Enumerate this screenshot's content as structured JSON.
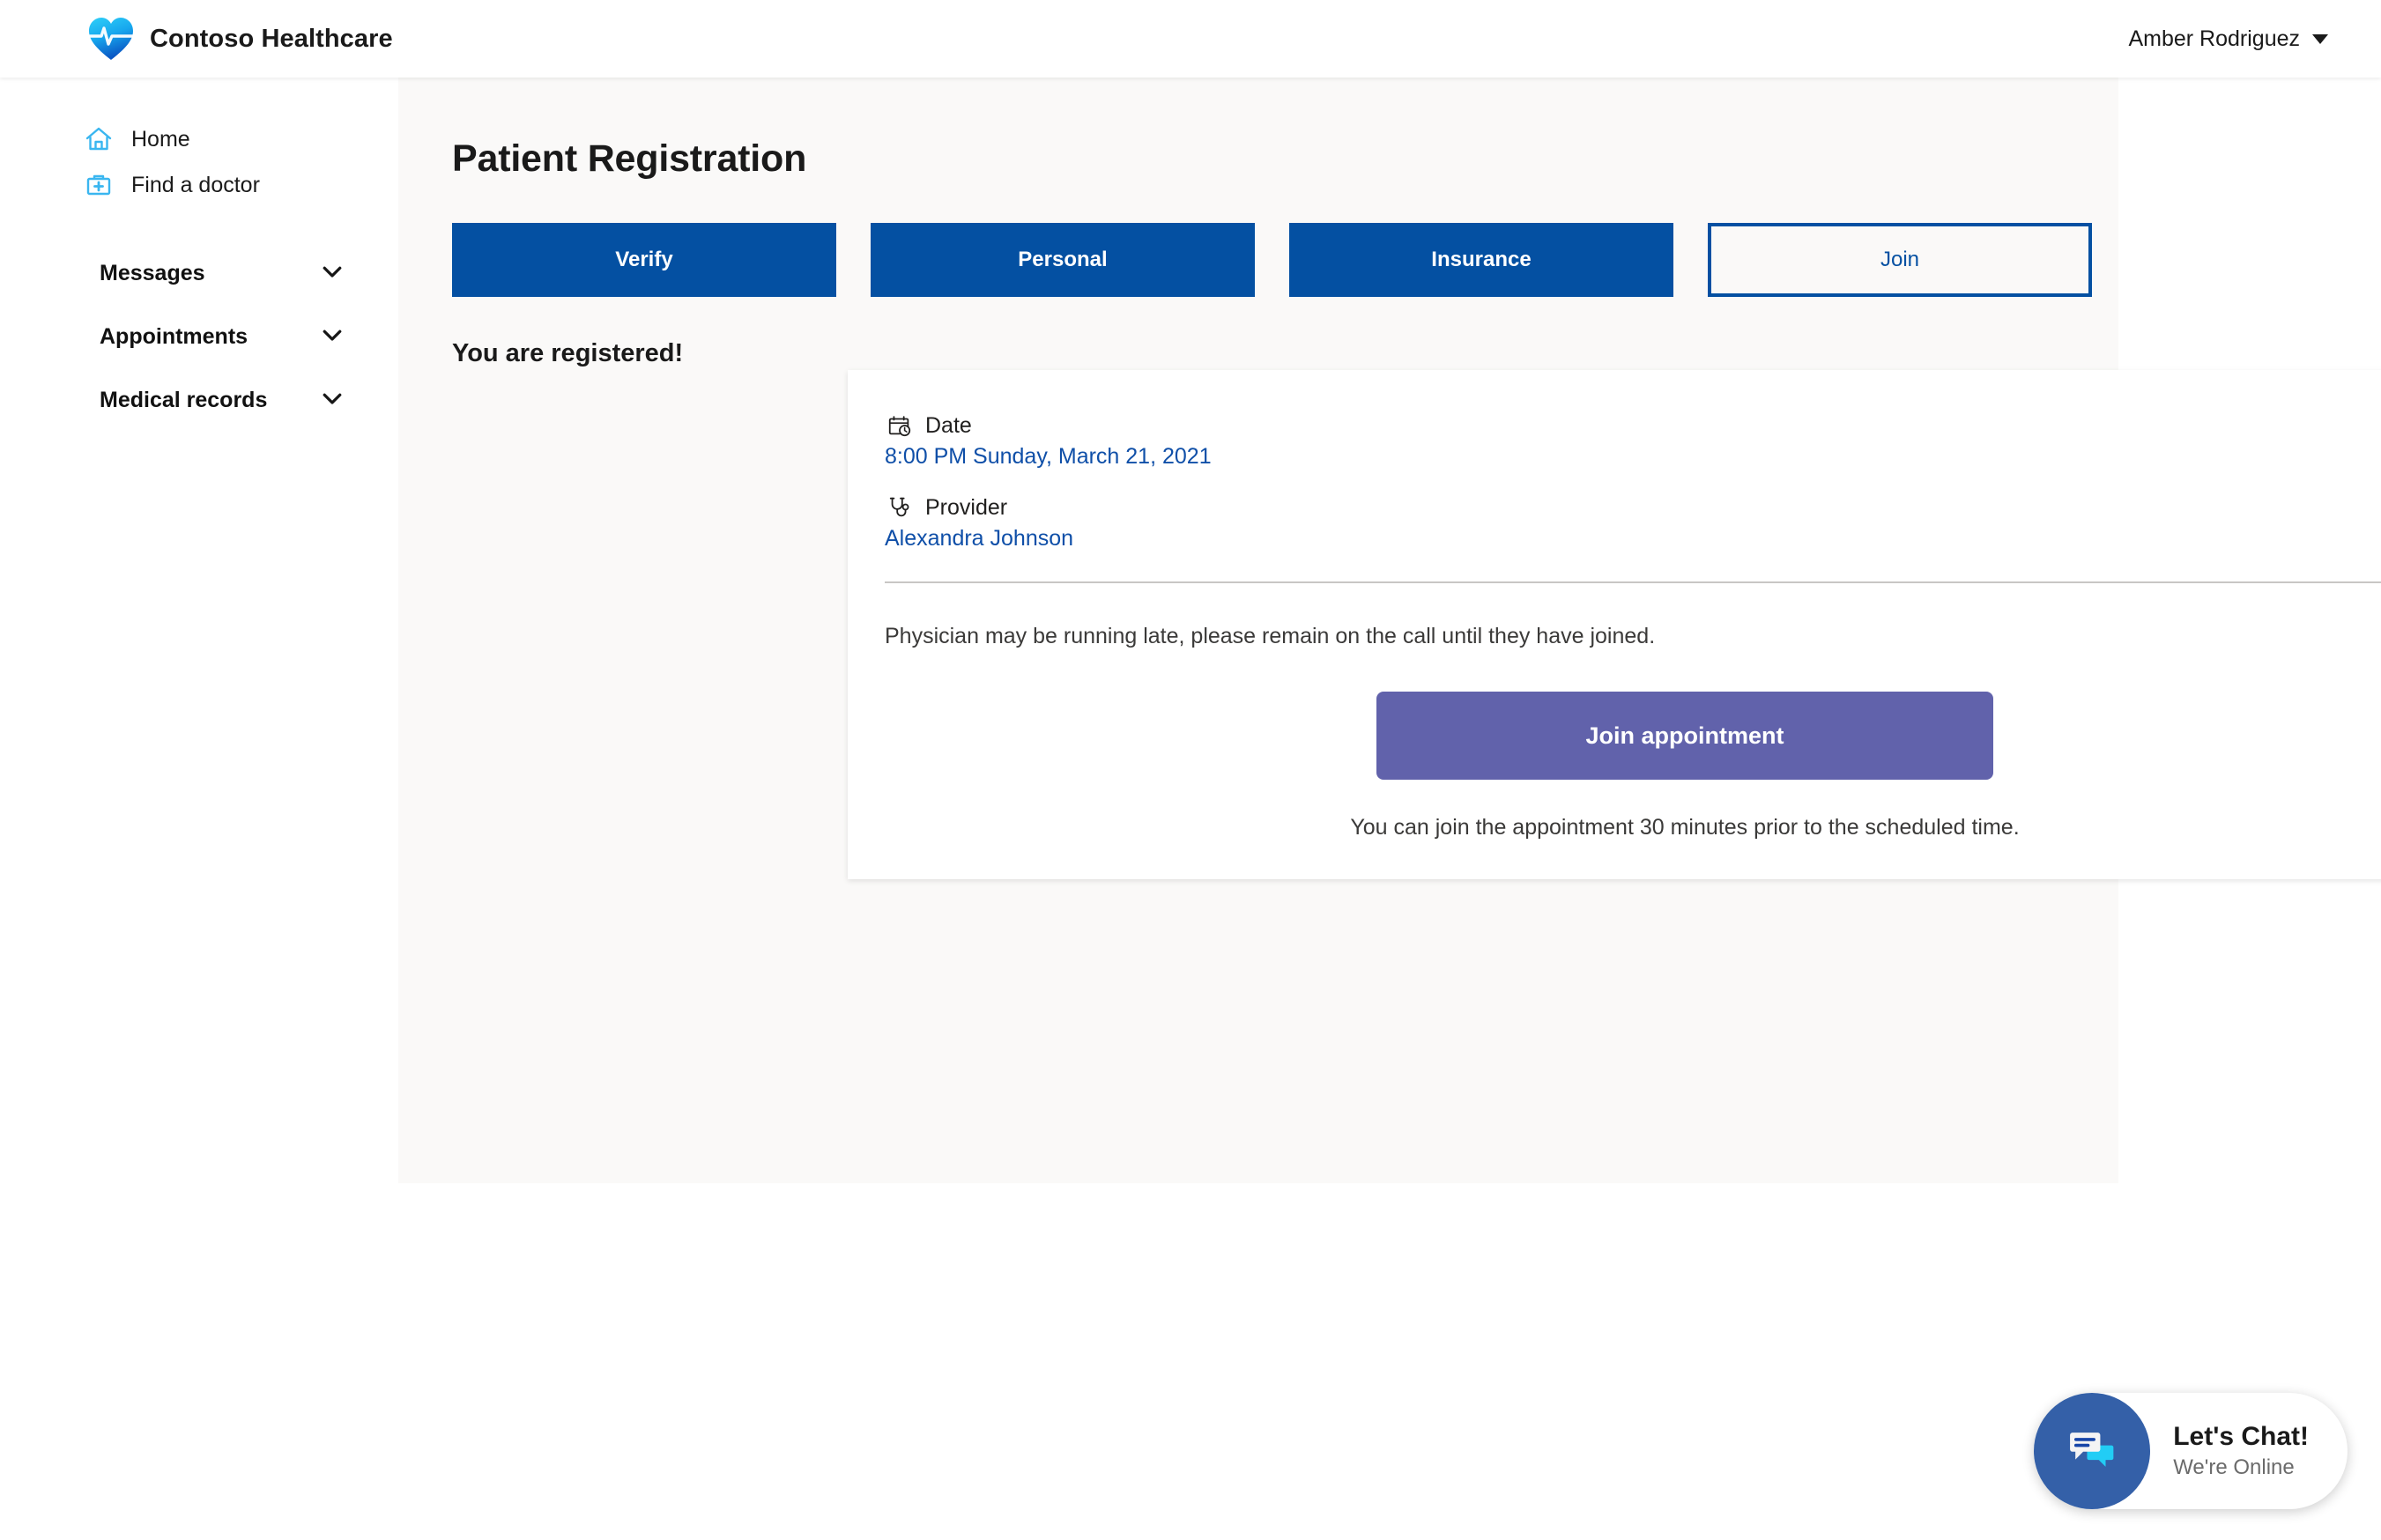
{
  "header": {
    "brand_name": "Contoso Healthcare",
    "logo_icon": "heart-pulse-icon",
    "user_name": "Amber Rodriguez",
    "caret_icon": "caret-down-icon",
    "accent_blue": "#0450a2",
    "logo_cyan": "#2cc4f5"
  },
  "sidebar": {
    "links": [
      {
        "label": "Home",
        "icon": "home-icon"
      },
      {
        "label": "Find a doctor",
        "icon": "medical-bag-icon"
      }
    ],
    "groups": [
      {
        "label": "Messages",
        "icon": "chevron-down-icon"
      },
      {
        "label": "Appointments",
        "icon": "chevron-down-icon"
      },
      {
        "label": "Medical records",
        "icon": "chevron-down-icon"
      }
    ]
  },
  "main": {
    "page_title": "Patient Registration",
    "tabs": [
      {
        "label": "Verify",
        "state": "filled"
      },
      {
        "label": "Personal",
        "state": "filled"
      },
      {
        "label": "Insurance",
        "state": "filled"
      },
      {
        "label": "Join",
        "state": "outlined"
      }
    ],
    "registered_heading": "You are registered!",
    "card": {
      "date_label": "Date",
      "date_icon": "calendar-clock-icon",
      "date_value": "8:00 PM Sunday, March 21, 2021",
      "provider_label": "Provider",
      "provider_icon": "stethoscope-icon",
      "provider_value": "Alexandra Johnson",
      "late_notice": "Physician may be running late, please remain on the call until they have joined.",
      "join_button_label": "Join appointment",
      "join_button_color": "#6162ab",
      "join_hint": "You can join the appointment 30 minutes prior to the scheduled time."
    }
  },
  "chat_widget": {
    "icon": "chat-bubbles-icon",
    "title": "Let's Chat!",
    "subtitle": "We're Online",
    "avatar_color": "#3460a8"
  }
}
